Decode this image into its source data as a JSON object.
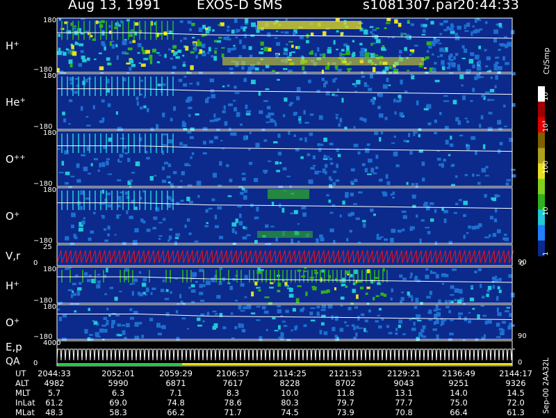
{
  "header": {
    "date": "Aug 13, 1991",
    "instrument": "EXOS-D SMS",
    "file": "s1081307.par",
    "time": "20:44:33"
  },
  "colors": {
    "background": "#000000",
    "panel_bg": "#0b2a8c",
    "panel_noise": "#1e6fd0",
    "cyan": "#21c8d8",
    "green": "#2fb020",
    "yellow": "#e8e020",
    "red": "#e00000",
    "white": "#ffffff",
    "red_trace": "#ff1010",
    "qa_green": "#20d040",
    "qa_yellow": "#e8e020"
  },
  "colorbar": {
    "unit": "Ct/Smp",
    "ticks": [
      "10⁴",
      "10³",
      "100",
      "10",
      "1"
    ]
  },
  "chart_data": {
    "type": "heatmap",
    "title": "Aug 13, 1991   EXOS-D SMS   s1081307.par   20:44:33",
    "xlabel": "UT",
    "x_ticks": [
      "2044:33",
      "2052:01",
      "2059:29",
      "2106:57",
      "2114:25",
      "2121:53",
      "2129:21",
      "2136:49",
      "2144:17"
    ],
    "panels": [
      {
        "name": "H+",
        "species": "H",
        "charge": "+",
        "ylabel_top": "180",
        "ylabel_bottom": "−180",
        "yrange": [
          -180,
          180
        ]
      },
      {
        "name": "He+",
        "species": "He",
        "charge": "+",
        "ylabel_top": "180",
        "ylabel_bottom": "−180",
        "yrange": [
          -180,
          180
        ]
      },
      {
        "name": "O++",
        "species": "O",
        "charge": "++",
        "ylabel_top": "180",
        "ylabel_bottom": "−180",
        "yrange": [
          -180,
          180
        ]
      },
      {
        "name": "O+",
        "species": "O",
        "charge": "+",
        "ylabel_top": "180",
        "ylabel_bottom": "−180",
        "yrange": [
          -180,
          180
        ]
      },
      {
        "name": "V,r",
        "species": "V,r",
        "charge": "",
        "ylabel_top": "25",
        "ylabel_bottom": "0",
        "right_label": "90",
        "right_bottom": "0",
        "yrange": [
          0,
          25
        ]
      },
      {
        "name": "H+",
        "species": "H",
        "charge": "+",
        "ylabel_top": "180",
        "ylabel_bottom": "−180",
        "yrange": [
          -180,
          180
        ]
      },
      {
        "name": "O+",
        "species": "O",
        "charge": "+",
        "ylabel_top": "180",
        "ylabel_bottom": "−180",
        "right_label": "90",
        "yrange": [
          -180,
          180
        ]
      },
      {
        "name": "E,p QA",
        "species": "E,p",
        "sub": "QA",
        "ylabel_top": "4000",
        "ylabel_bottom": "0",
        "right_label": "0",
        "yrange": [
          0,
          4000
        ]
      }
    ]
  },
  "table": {
    "rows": [
      {
        "label": "UT",
        "values": [
          "2044:33",
          "2052:01",
          "2059:29",
          "2106:57",
          "2114:25",
          "2121:53",
          "2129:21",
          "2136:49",
          "2144:17"
        ]
      },
      {
        "label": "ALT",
        "values": [
          "4982",
          "5990",
          "6871",
          "7617",
          "8228",
          "8702",
          "9043",
          "9251",
          "9326"
        ]
      },
      {
        "label": "MLT",
        "values": [
          "5.7",
          "6.3",
          "7.1",
          "8.3",
          "10.0",
          "11.8",
          "13.1",
          "14.0",
          "14.5"
        ]
      },
      {
        "label": "InLat",
        "values": [
          "61.2",
          "69.0",
          "74.8",
          "78.6",
          "80.3",
          "79.7",
          "77.7",
          "75.0",
          "72.0"
        ]
      },
      {
        "label": "MLat",
        "values": [
          "48.3",
          "58.3",
          "66.2",
          "71.7",
          "74.5",
          "73.9",
          "70.8",
          "66.4",
          "61.3"
        ]
      }
    ]
  },
  "footer": {
    "code": "Sep-00  2AA32L"
  }
}
